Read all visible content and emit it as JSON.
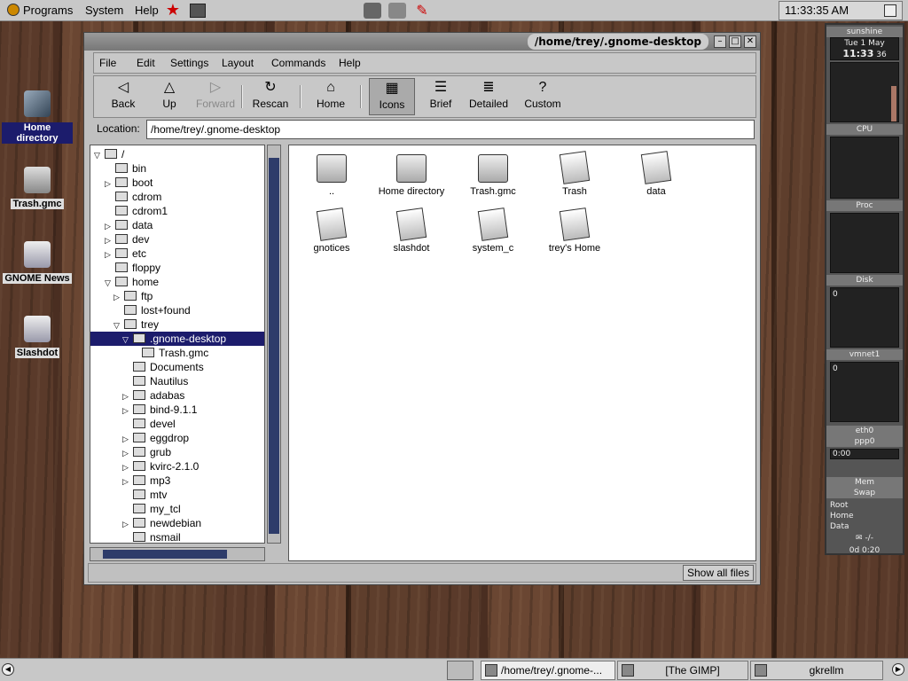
{
  "panel": {
    "programs": "Programs",
    "system": "System",
    "help": "Help",
    "clock": "11:33:35 AM"
  },
  "window": {
    "title": "/home/trey/.gnome-desktop"
  },
  "menubar": [
    "File",
    "Edit",
    "Settings",
    "Layout",
    "Commands",
    "Help"
  ],
  "toolbar": {
    "back": "Back",
    "up": "Up",
    "forward": "Forward",
    "rescan": "Rescan",
    "home": "Home",
    "icons": "Icons",
    "brief": "Brief",
    "detailed": "Detailed",
    "custom": "Custom"
  },
  "location": {
    "label": "Location:",
    "value": "/home/trey/.gnome-desktop"
  },
  "tree": [
    "/",
    "bin",
    "boot",
    "cdrom",
    "cdrom1",
    "data",
    "dev",
    "etc",
    "floppy",
    "home",
    "ftp",
    "lost+found",
    "trey",
    ".gnome-desktop",
    "Trash.gmc",
    "Documents",
    "Nautilus",
    "adabas",
    "bind-9.1.1",
    "devel",
    "eggdrop",
    "grub",
    "kvirc-2.1.0",
    "mp3",
    "mtv",
    "my_tcl",
    "newdebian",
    "nsmail"
  ],
  "files": [
    "..",
    "Home directory",
    "Trash.gmc",
    "Trash",
    "data",
    "gnotices",
    "slashdot",
    "system_c",
    "trey's Home"
  ],
  "status": {
    "show_all": "Show all files"
  },
  "desktop": {
    "home": "Home directory",
    "trash": "Trash.gmc",
    "news": "GNOME News",
    "slashdot": "Slashdot"
  },
  "gkrellm": {
    "host": "sunshine",
    "date_day": "Tue",
    "date_num": "1",
    "date_month": "May",
    "time": "11:33",
    "sec": "36",
    "cpu": "CPU",
    "proc": "Proc",
    "disk": "Disk",
    "vmnet": "vmnet1",
    "zero1": "0",
    "zero2": "0",
    "eth": "eth0",
    "ppp": "ppp0",
    "net_time": "0:00",
    "mem": "Mem",
    "swap": "Swap",
    "root": "Root",
    "home": "Home",
    "data": "Data",
    "sep": "-/-",
    "uptime": "0d 0:20"
  },
  "taskbar": {
    "t1": "/home/trey/.gnome-...",
    "t2": "[The GIMP]",
    "t3": "gkrellm"
  }
}
